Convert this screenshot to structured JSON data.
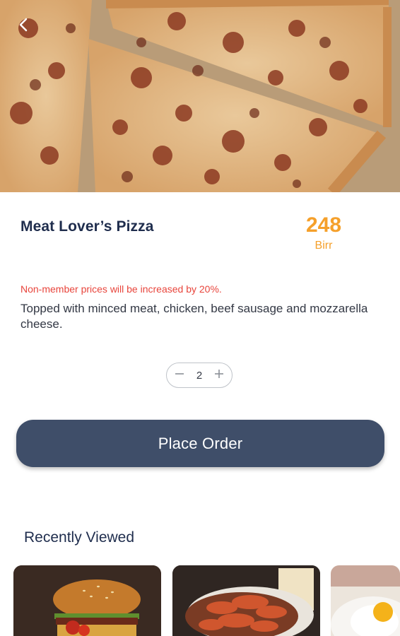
{
  "product": {
    "name": "Meat Lover’s Pizza",
    "price": "248",
    "currency": "Birr",
    "notice": "Non-member prices will be increased by 20%.",
    "description": "Topped with minced meat, chicken, beef sausage and mozzarella cheese."
  },
  "quantity": {
    "value": "2"
  },
  "actions": {
    "place_order_label": "Place Order"
  },
  "recently_viewed": {
    "title": "Recently Viewed",
    "items": [
      {
        "image": "burger"
      },
      {
        "image": "pasta"
      },
      {
        "image": "fried-egg"
      }
    ]
  },
  "icons": {
    "back": "chevron-left-icon",
    "minus": "minus-icon",
    "plus": "plus-icon"
  },
  "colors": {
    "title": "#1f2d4d",
    "price": "#f5a02b",
    "notice": "#e8453c",
    "button": "#3f4e69"
  }
}
